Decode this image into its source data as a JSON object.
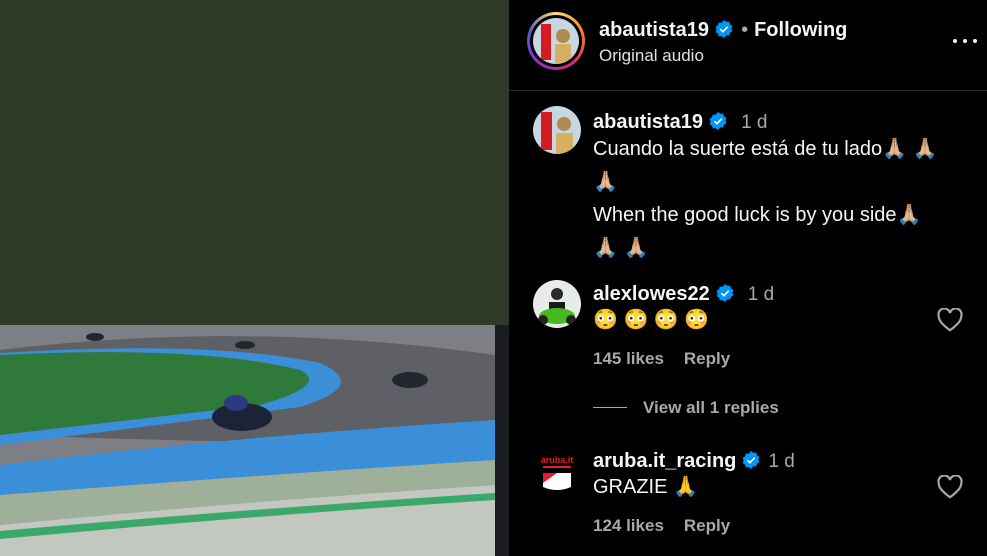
{
  "post": {
    "username": "abautista19",
    "follow_status": "Following",
    "separator": "•",
    "audio": "Original audio"
  },
  "comments": [
    {
      "username": "abautista19",
      "time": "1 d",
      "lines": [
        "Cuando la suerte está de tu lado🙏🏼 🙏🏼",
        "🙏🏼",
        "When the good luck is by you side🙏🏼",
        "🙏🏼 🙏🏼"
      ]
    },
    {
      "username": "alexlowes22",
      "time": "1 d",
      "text": "😳 😳 😳 😳",
      "likes": "145 likes",
      "reply": "Reply",
      "view_replies": "View all 1 replies"
    },
    {
      "username": "aruba.it_racing",
      "time": "1 d",
      "text": "GRAZIE 🙏",
      "likes": "124 likes",
      "reply": "Reply"
    }
  ],
  "colors": {
    "background": "#000000",
    "verified": "#0095f6",
    "muted": "#a8a8a8",
    "media_bg": "#2f3a28"
  },
  "icons": [
    "verified-badge-icon",
    "more-options-icon",
    "heart-icon"
  ]
}
